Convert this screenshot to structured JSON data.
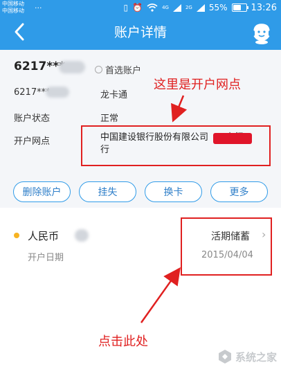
{
  "status_bar": {
    "carrier1": "中国移动",
    "carrier2": "中国移动",
    "dots": "...",
    "signal_tag1": "4G",
    "signal_tag2": "2G",
    "battery": "55%",
    "battery_level": 0.55,
    "time": "13:26"
  },
  "header": {
    "title": "账户详情",
    "back_icon": "chevron-left-icon",
    "service_icon": "customer-service-icon"
  },
  "account": {
    "number_main": "6217***",
    "primary_label": "首选账户",
    "rows": [
      {
        "label": "6217***",
        "value": "龙卡通"
      },
      {
        "label": "账户状态",
        "value": "正常"
      },
      {
        "label": "开户网点",
        "value": "中国建设银行股份有限公司"
      },
      {
        "label": "",
        "value": "行"
      }
    ],
    "branch_tail": "支行"
  },
  "buttons": [
    "删除账户",
    "挂失",
    "换卡",
    "更多"
  ],
  "list": {
    "currency": "人民币",
    "type": "活期储蓄",
    "date_label": "开户日期",
    "date_value": "2015/04/04",
    "chevron": "›"
  },
  "annotations": {
    "top_text": "这里是开户网点",
    "bottom_text": "点击此处",
    "color": "#e02020"
  },
  "watermark": {
    "text": "系统之家"
  },
  "colors": {
    "primary": "#2f9be8",
    "button_text": "#2f7fc9",
    "dot": "#f7b322"
  }
}
